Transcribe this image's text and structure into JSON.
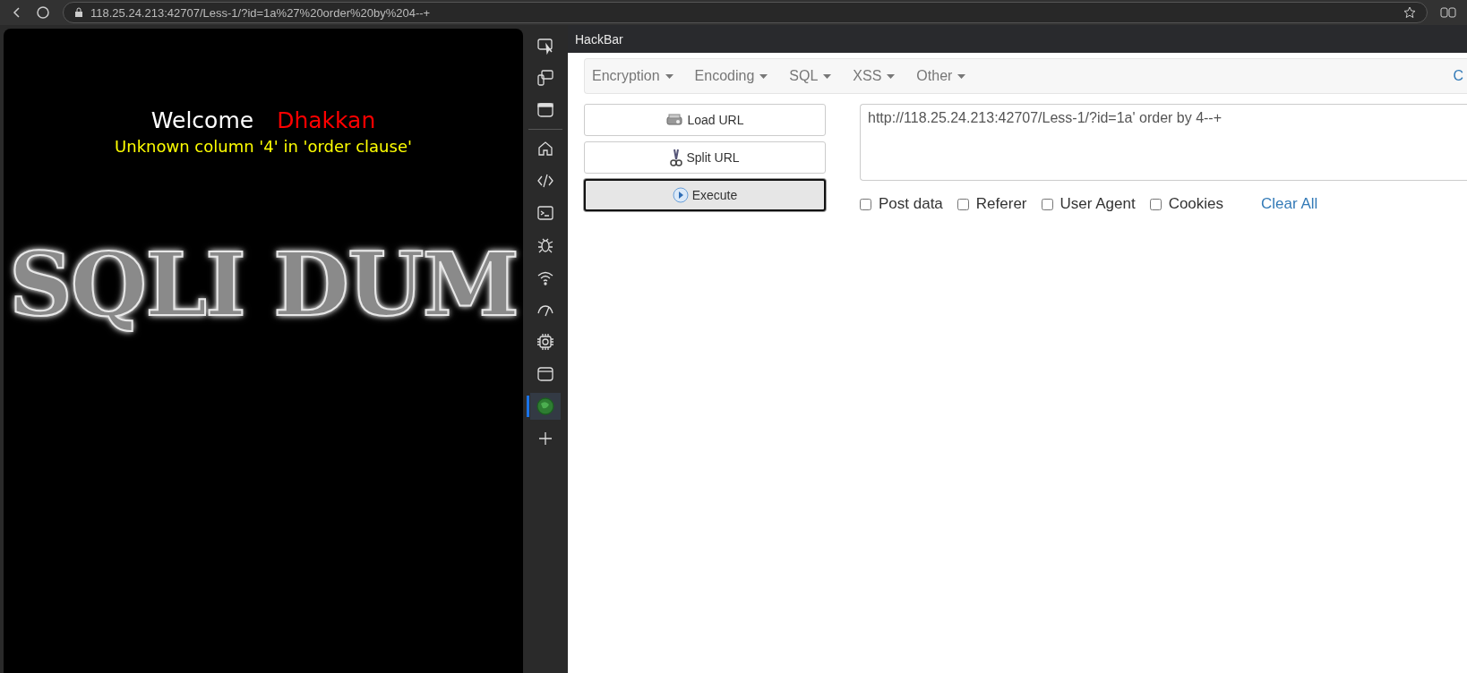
{
  "browser": {
    "address": "118.25.24.213:42707/Less-1/?id=1a%27%20order%20by%204--+"
  },
  "page": {
    "greeting": "Welcome",
    "name": "Dhakkan",
    "error": "Unknown column '4' in 'order clause'",
    "logo_text": "SQLI DUM"
  },
  "sidebar": {
    "top_items": [
      {
        "kind": "inspect",
        "selected": false
      },
      {
        "kind": "device",
        "selected": false
      },
      {
        "kind": "window",
        "selected": false
      }
    ],
    "items": [
      {
        "kind": "home",
        "selected": false
      },
      {
        "kind": "code",
        "selected": false
      },
      {
        "kind": "console",
        "selected": false
      },
      {
        "kind": "bug",
        "selected": false
      },
      {
        "kind": "wifi",
        "selected": false
      },
      {
        "kind": "gauge",
        "selected": false
      },
      {
        "kind": "chip",
        "selected": false
      },
      {
        "kind": "panel",
        "selected": false
      },
      {
        "kind": "hackbar",
        "selected": true
      },
      {
        "kind": "add",
        "selected": false
      }
    ]
  },
  "hackbar": {
    "title": "HackBar",
    "menus": [
      {
        "label": "Encryption"
      },
      {
        "label": "Encoding"
      },
      {
        "label": "SQL"
      },
      {
        "label": "XSS"
      },
      {
        "label": "Other"
      }
    ],
    "menu_right": "C",
    "buttons": [
      {
        "kind": "load",
        "label": "Load URL",
        "focused": false
      },
      {
        "kind": "split",
        "label": "Split URL",
        "focused": false
      },
      {
        "kind": "execute",
        "label": "Execute",
        "focused": true
      }
    ],
    "url": "http://118.25.24.213:42707/Less-1/?id=1a' order by 4--+",
    "options": [
      {
        "label": "Post data",
        "checked": false
      },
      {
        "label": "Referer",
        "checked": false
      },
      {
        "label": "User Agent",
        "checked": false
      },
      {
        "label": "Cookies",
        "checked": false
      }
    ],
    "clear_all": "Clear All"
  }
}
